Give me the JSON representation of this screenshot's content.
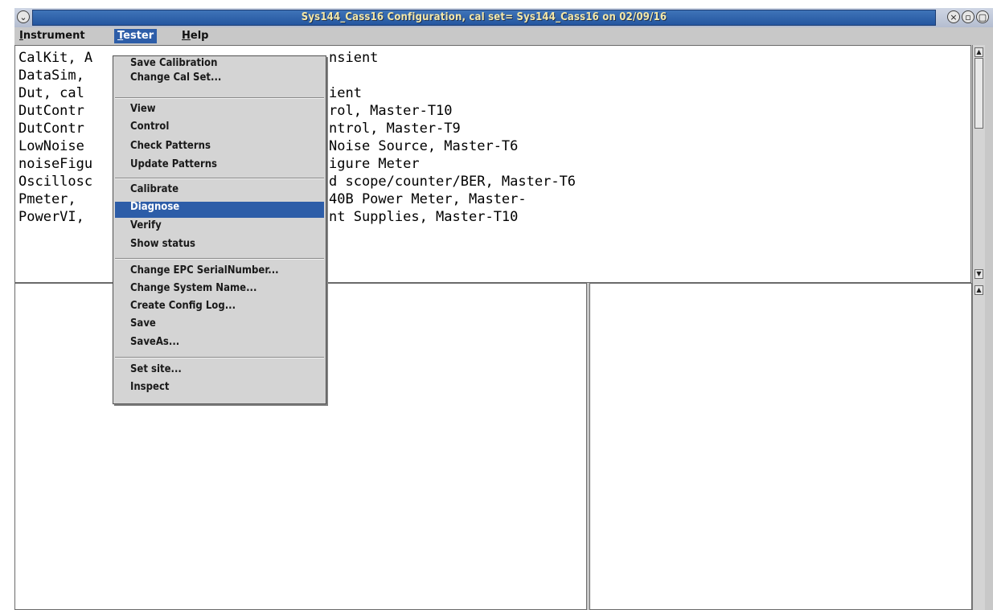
{
  "window": {
    "title": "Sys144_Cass16 Configuration, cal set= Sys144_Cass16 on 02/09/16",
    "buttons": {
      "menu": "⌄",
      "close": "×",
      "minimize": "▫",
      "maximize": "▢"
    }
  },
  "menubar": {
    "items": [
      {
        "label": "Instrument",
        "mnemonic": "I",
        "rest": "nstrument"
      },
      {
        "label": "Tester",
        "mnemonic": "T",
        "rest": "ester"
      },
      {
        "label": "Help",
        "mnemonic": "H",
        "rest": "elp"
      }
    ]
  },
  "instrument_list": [
    "CalKit, A",
    "DataSim,",
    "Dut, cal",
    "DutContr",
    "DutContr",
    "LowNoise",
    "noiseFigu",
    "Oscillosc",
    "Pmeter,",
    "PowerVI,"
  ],
  "instrument_list_right": [
    "nsient",
    "",
    "ient",
    "rol, Master-T10",
    "ntrol, Master-T9",
    "Noise Source, Master-T6",
    "igure Meter",
    "d scope/counter/BER, Master-T6",
    "40B Power Meter, Master-",
    "nt Supplies, Master-T10"
  ],
  "tester_menu": {
    "groups": [
      [
        "Save Calibration",
        "Change Cal Set..."
      ],
      [
        "View",
        "Control",
        "Check Patterns",
        "Update Patterns"
      ],
      [
        "Calibrate",
        "Diagnose",
        "Verify",
        "Show status"
      ],
      [
        "Change EPC SerialNumber...",
        "Change System Name...",
        "Create Config Log...",
        "Save",
        "SaveAs..."
      ],
      [
        "Set site...",
        "Inspect"
      ]
    ],
    "highlighted": "Diagnose"
  },
  "colors": {
    "title_bg": "#2d5da8",
    "title_text": "#f4e8a8",
    "highlight": "#2d5da8",
    "chrome": "#c8c8c8"
  }
}
